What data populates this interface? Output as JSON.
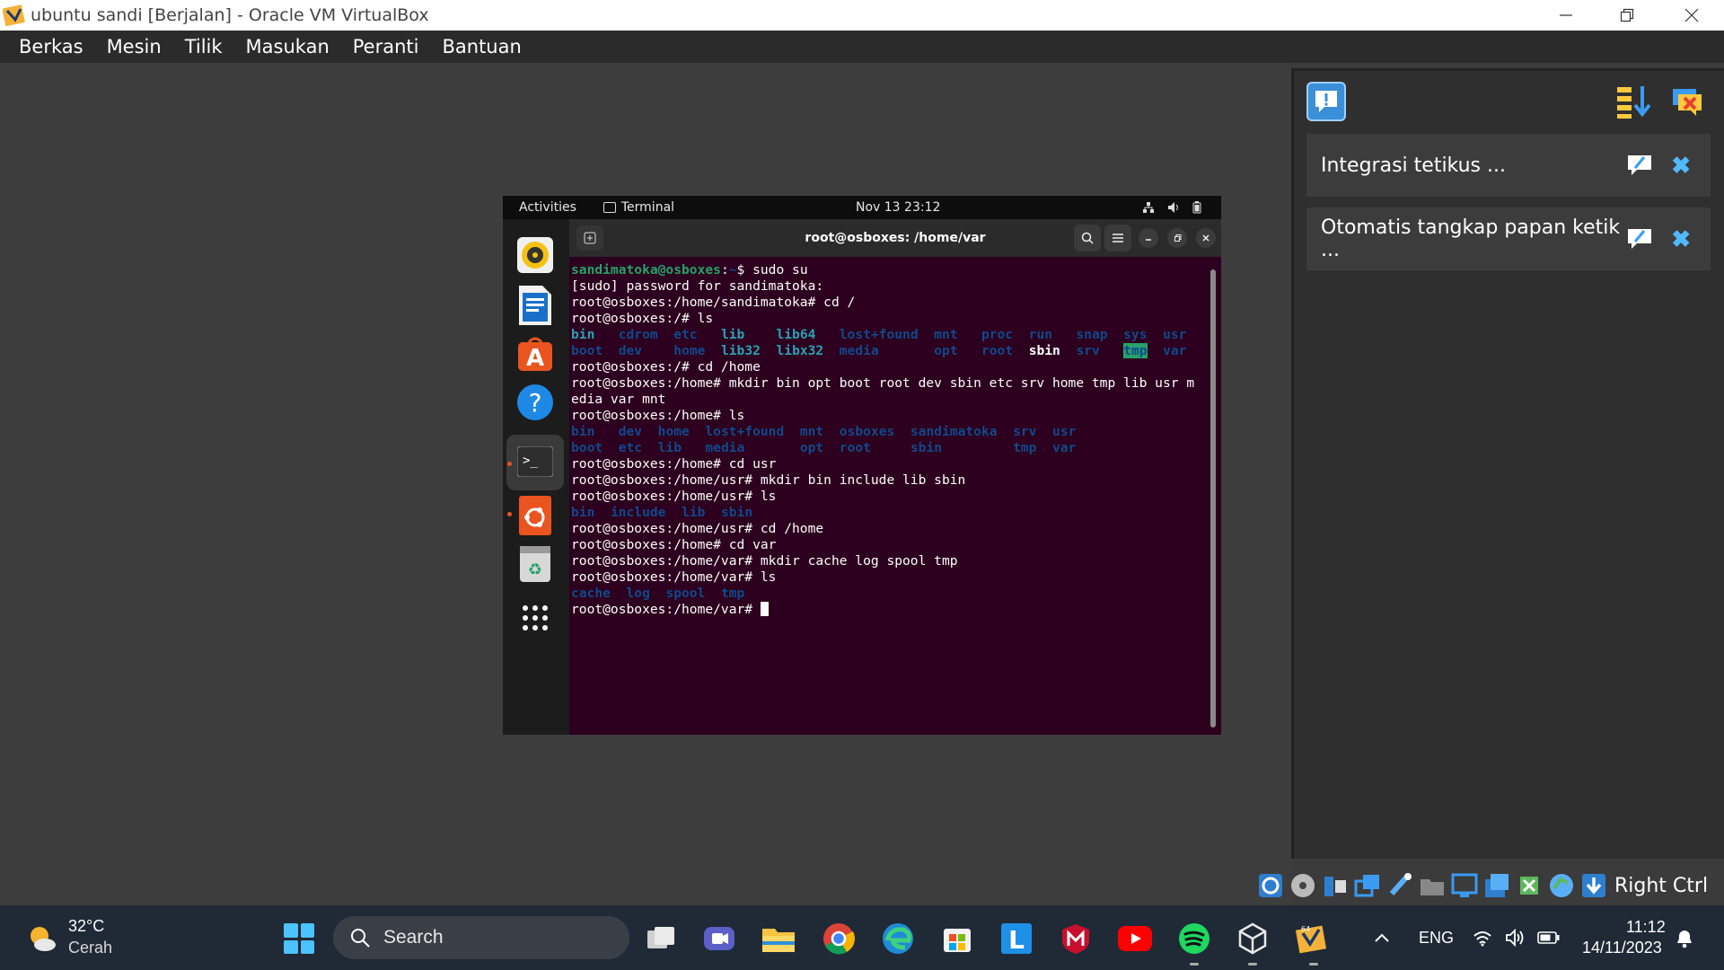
{
  "window": {
    "title": "ubuntu sandi [Berjalan] - Oracle VM VirtualBox",
    "controls": [
      "minimize",
      "restore",
      "close"
    ]
  },
  "menu": {
    "items": [
      "Berkas",
      "Mesin",
      "Tilik",
      "Masukan",
      "Peranti",
      "Bantuan"
    ]
  },
  "side_panel": {
    "notifications": [
      {
        "text": "Integrasi tetikus ..."
      },
      {
        "text": "Otomatis tangkap papan ketik ..."
      }
    ]
  },
  "vm_status": {
    "host_key": "Right Ctrl"
  },
  "guest": {
    "topbar": {
      "activities": "Activities",
      "app": "Terminal",
      "clock": "Nov 13  23:12"
    },
    "terminal": {
      "title": "root@osboxes: /home/var",
      "lines": [
        [
          {
            "t": "sandimatoka@osboxes",
            "c": "c-green"
          },
          {
            "t": ":",
            "c": ""
          },
          {
            "t": "~",
            "c": "c-blue"
          },
          {
            "t": "$ sudo su",
            "c": ""
          }
        ],
        [
          {
            "t": "[sudo] password for sandimatoka:",
            "c": ""
          }
        ],
        [
          {
            "t": "root@osboxes:/home/sandimatoka# cd /",
            "c": ""
          }
        ],
        [
          {
            "t": "root@osboxes:/# ls",
            "c": ""
          }
        ],
        [
          {
            "t": "bin",
            "c": "c-cyan"
          },
          {
            "t": "   ",
            "c": ""
          },
          {
            "t": "cdrom",
            "c": "c-blue"
          },
          {
            "t": "  ",
            "c": ""
          },
          {
            "t": "etc",
            "c": "c-blue"
          },
          {
            "t": "   ",
            "c": ""
          },
          {
            "t": "lib",
            "c": "c-cyan"
          },
          {
            "t": "    ",
            "c": ""
          },
          {
            "t": "lib64",
            "c": "c-cyan"
          },
          {
            "t": "   ",
            "c": ""
          },
          {
            "t": "lost+found",
            "c": "c-blue"
          },
          {
            "t": "  ",
            "c": ""
          },
          {
            "t": "mnt",
            "c": "c-blue"
          },
          {
            "t": "   ",
            "c": ""
          },
          {
            "t": "proc",
            "c": "c-blue"
          },
          {
            "t": "  ",
            "c": ""
          },
          {
            "t": "run",
            "c": "c-blue"
          },
          {
            "t": "   ",
            "c": ""
          },
          {
            "t": "snap",
            "c": "c-blue"
          },
          {
            "t": "  ",
            "c": ""
          },
          {
            "t": "sys",
            "c": "c-blue"
          },
          {
            "t": "  ",
            "c": ""
          },
          {
            "t": "usr",
            "c": "c-blue"
          }
        ],
        [
          {
            "t": "boot",
            "c": "c-blue"
          },
          {
            "t": "  ",
            "c": ""
          },
          {
            "t": "dev",
            "c": "c-blue"
          },
          {
            "t": "    ",
            "c": ""
          },
          {
            "t": "home",
            "c": "c-blue"
          },
          {
            "t": "  ",
            "c": ""
          },
          {
            "t": "lib32",
            "c": "c-cyan"
          },
          {
            "t": "  ",
            "c": ""
          },
          {
            "t": "libx32",
            "c": "c-cyan"
          },
          {
            "t": "  ",
            "c": ""
          },
          {
            "t": "media",
            "c": "c-blue"
          },
          {
            "t": "       ",
            "c": ""
          },
          {
            "t": "opt",
            "c": "c-blue"
          },
          {
            "t": "   ",
            "c": ""
          },
          {
            "t": "root",
            "c": "c-blue"
          },
          {
            "t": "  ",
            "c": ""
          },
          {
            "t": "sbin",
            "c": "c-sbin"
          },
          {
            "t": "  ",
            "c": ""
          },
          {
            "t": "srv",
            "c": "c-blue"
          },
          {
            "t": "   ",
            "c": ""
          },
          {
            "t": "tmp",
            "c": "c-tmp"
          },
          {
            "t": "  ",
            "c": ""
          },
          {
            "t": "var",
            "c": "c-blue"
          }
        ],
        [
          {
            "t": "root@osboxes:/# cd /home",
            "c": ""
          }
        ],
        [
          {
            "t": "root@osboxes:/home# mkdir bin opt boot root dev sbin etc srv home tmp lib usr m",
            "c": ""
          }
        ],
        [
          {
            "t": "edia var mnt",
            "c": ""
          }
        ],
        [
          {
            "t": "root@osboxes:/home# ls",
            "c": ""
          }
        ],
        [
          {
            "t": "bin",
            "c": "c-blue"
          },
          {
            "t": "   ",
            "c": ""
          },
          {
            "t": "dev",
            "c": "c-blue"
          },
          {
            "t": "  ",
            "c": ""
          },
          {
            "t": "home",
            "c": "c-blue"
          },
          {
            "t": "  ",
            "c": ""
          },
          {
            "t": "lost+found",
            "c": "c-blue"
          },
          {
            "t": "  ",
            "c": ""
          },
          {
            "t": "mnt",
            "c": "c-blue"
          },
          {
            "t": "  ",
            "c": ""
          },
          {
            "t": "osboxes",
            "c": "c-blue"
          },
          {
            "t": "  ",
            "c": ""
          },
          {
            "t": "sandimatoka",
            "c": "c-blue"
          },
          {
            "t": "  ",
            "c": ""
          },
          {
            "t": "srv",
            "c": "c-blue"
          },
          {
            "t": "  ",
            "c": ""
          },
          {
            "t": "usr",
            "c": "c-blue"
          }
        ],
        [
          {
            "t": "boot",
            "c": "c-blue"
          },
          {
            "t": "  ",
            "c": ""
          },
          {
            "t": "etc",
            "c": "c-blue"
          },
          {
            "t": "  ",
            "c": ""
          },
          {
            "t": "lib",
            "c": "c-blue"
          },
          {
            "t": "   ",
            "c": ""
          },
          {
            "t": "media",
            "c": "c-blue"
          },
          {
            "t": "       ",
            "c": ""
          },
          {
            "t": "opt",
            "c": "c-blue"
          },
          {
            "t": "  ",
            "c": ""
          },
          {
            "t": "root",
            "c": "c-blue"
          },
          {
            "t": "     ",
            "c": ""
          },
          {
            "t": "sbin",
            "c": "c-blue"
          },
          {
            "t": "         ",
            "c": ""
          },
          {
            "t": "tmp",
            "c": "c-blue"
          },
          {
            "t": "  ",
            "c": ""
          },
          {
            "t": "var",
            "c": "c-blue"
          }
        ],
        [
          {
            "t": "root@osboxes:/home# cd usr",
            "c": ""
          }
        ],
        [
          {
            "t": "root@osboxes:/home/usr# mkdir bin include lib sbin",
            "c": ""
          }
        ],
        [
          {
            "t": "root@osboxes:/home/usr# ls",
            "c": ""
          }
        ],
        [
          {
            "t": "bin",
            "c": "c-blue"
          },
          {
            "t": "  ",
            "c": ""
          },
          {
            "t": "include",
            "c": "c-blue"
          },
          {
            "t": "  ",
            "c": ""
          },
          {
            "t": "lib",
            "c": "c-blue"
          },
          {
            "t": "  ",
            "c": ""
          },
          {
            "t": "sbin",
            "c": "c-blue"
          }
        ],
        [
          {
            "t": "root@osboxes:/home/usr# cd /home",
            "c": ""
          }
        ],
        [
          {
            "t": "root@osboxes:/home# cd var",
            "c": ""
          }
        ],
        [
          {
            "t": "root@osboxes:/home/var# mkdir cache log spool tmp",
            "c": ""
          }
        ],
        [
          {
            "t": "root@osboxes:/home/var# ls",
            "c": ""
          }
        ],
        [
          {
            "t": "cache",
            "c": "c-blue"
          },
          {
            "t": "  ",
            "c": ""
          },
          {
            "t": "log",
            "c": "c-blue"
          },
          {
            "t": "  ",
            "c": ""
          },
          {
            "t": "spool",
            "c": "c-blue"
          },
          {
            "t": "  ",
            "c": ""
          },
          {
            "t": "tmp",
            "c": "c-blue"
          }
        ],
        [
          {
            "t": "root@osboxes:/home/var# ",
            "c": ""
          },
          {
            "t": "",
            "c": "cursor"
          }
        ]
      ]
    }
  },
  "taskbar": {
    "weather": {
      "temp": "32°C",
      "condition": "Cerah"
    },
    "search_placeholder": "Search",
    "language": "ENG",
    "time": "11:12",
    "date": "14/11/2023"
  },
  "colors": {
    "terminal_bg": "#2c001e",
    "ubuntu_orange": "#e95420",
    "taskbar_bg": "#1f2a36",
    "accent_blue": "#4cc2ff"
  }
}
